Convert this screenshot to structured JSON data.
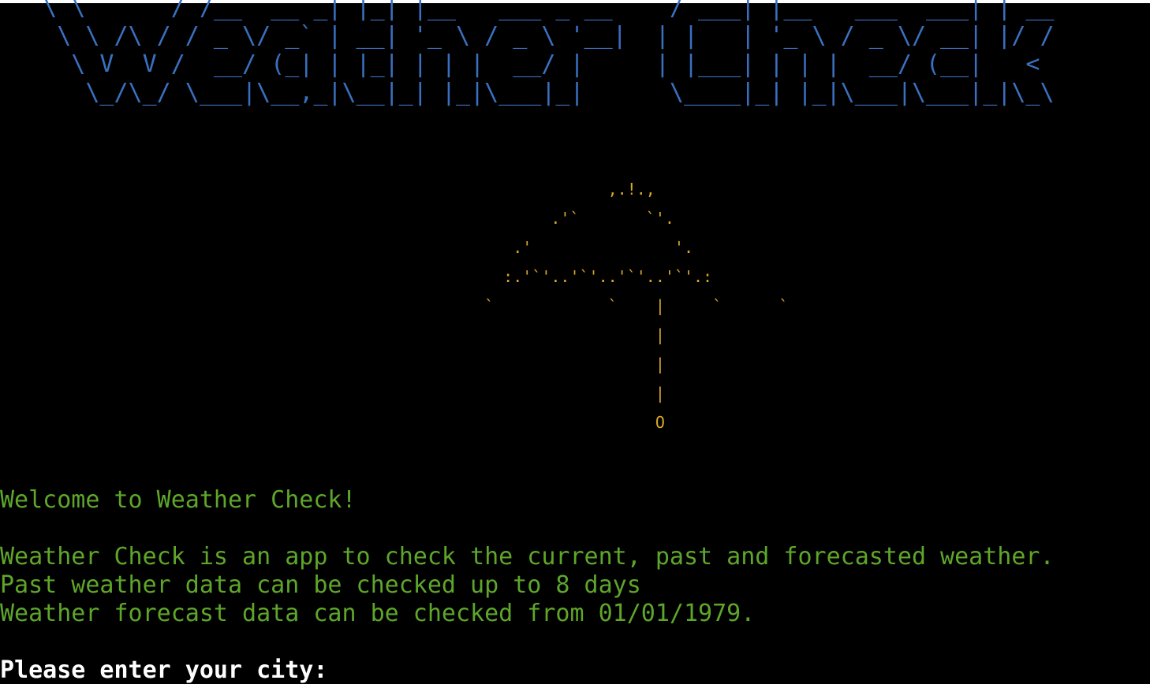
{
  "colors": {
    "background": "#000000",
    "banner": "#3a70c0",
    "umbrella": "#d7a82a",
    "message": "#5ea62a",
    "prompt": "#ffffff"
  },
  "banner": {
    "line_1": "   \\ \\      / /__  __ _| |_| |__   ___ _ __    / ___| |__   ___  ___| | __",
    "line_2": "    \\ \\ /\\ / / _ \\/ _` | __| '_ \\ / _ \\ '__|  | |   | '_ \\ / _ \\/ __| |/ /",
    "line_3": "     \\ V  V /  __/ (_| | |_| | | |  __/ |     | |___| | | |  __/ (__|   < ",
    "line_4": "      \\_/\\_/ \\___|\\__,_|\\__|_| |_|\\___|_|      \\____|_| |_|\\___|\\___|_|\\_\\"
  },
  "umbrella": {
    "line_1": "                                                                ,.!.,",
    "line_2": "                                                          .'`       `'.",
    "line_3": "                                                      .'               '.",
    "line_4": "                                                     :.'`'..'`'..'`'..'`'.:",
    "line_5": "                                                   `            `    |     `      `",
    "line_6": "                                                                     |",
    "line_7": "                                                                     |",
    "line_8": "                                                                     |",
    "line_9": "                                                                     O"
  },
  "messages": {
    "welcome": "Welcome to Weather Check!",
    "blank": "",
    "description_1": "Weather Check is an app to check the current, past and forecasted weather.",
    "description_2": "Past weather data can be checked up to 8 days",
    "description_3": "Weather forecast data can be checked from 01/01/1979."
  },
  "prompt": {
    "label": "Please enter your city: "
  }
}
